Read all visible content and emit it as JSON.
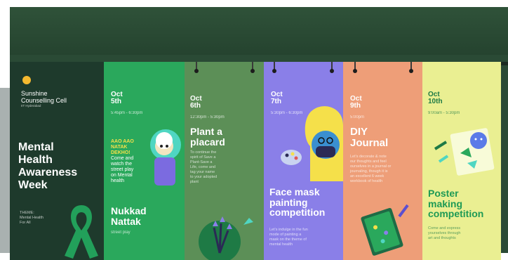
{
  "brand": {
    "name_line1": "Sunshine",
    "name_line2": "Counselling Cell",
    "subtitle": "IIT Hyderabad"
  },
  "intro": {
    "title_lines": [
      "Mental",
      "Health",
      "Awareness",
      "Week"
    ],
    "theme_lines": [
      "THEME:",
      "Mental Health",
      "For All"
    ]
  },
  "events": [
    {
      "date_line1": "Oct",
      "date_line2": "5th",
      "time": "5:45pm - 6:30pm",
      "blurb": [
        "AAO AAO",
        "NATAK",
        "DEKHO!",
        "Come and",
        "watch the",
        "street play",
        "on Mental",
        "health"
      ],
      "title_lines": [
        "Nukkad",
        "Nattak"
      ],
      "caption": "street play"
    },
    {
      "date_line1": "Oct",
      "date_line2": "6th",
      "time": "12:30pm - 5:30pm",
      "title_lines": [
        "Plant a",
        "placard"
      ],
      "desc_lines": [
        "To continue the",
        "spirit of Save a",
        "Plant-Save a",
        "Life, come and",
        "tag your name",
        "to your adopted",
        "plant"
      ]
    },
    {
      "date_line1": "Oct",
      "date_line2": "7th",
      "time": "5:30pm - 6:30pm",
      "title_lines": [
        "Face mask",
        "painting",
        "competition"
      ],
      "desc_lines": [
        "Let's indulge in the fun",
        "mode of painting a",
        "mask on the theme of",
        "mental health"
      ]
    },
    {
      "date_line1": "Oct",
      "date_line2": "9th",
      "time": "5:00pm",
      "title_lines": [
        "DIY",
        "Journal"
      ],
      "desc_lines": [
        "Let's decorate & note",
        "our thoughts and feel",
        "ourselves in a journal or",
        "journaling, though it is",
        "an excellent 6 week",
        "workbook of health"
      ]
    },
    {
      "date_line1": "Oct",
      "date_line2": "10th",
      "time": "9:00am - 5:30pm",
      "title_lines": [
        "Poster",
        "making",
        "competition"
      ],
      "desc_lines": [
        "Come and express",
        "yourselves through",
        "art and thoughts"
      ]
    }
  ],
  "colors": {
    "wall": "#2a4a35",
    "intro": "#1e3a2c",
    "event1": "#2aa85c",
    "event2": "#5c8f57",
    "event3": "#8a7fe8",
    "event4": "#ee9e78",
    "event5": "#eaef92",
    "yellow": "#f5e04a",
    "ribbon": "#22a05a"
  }
}
